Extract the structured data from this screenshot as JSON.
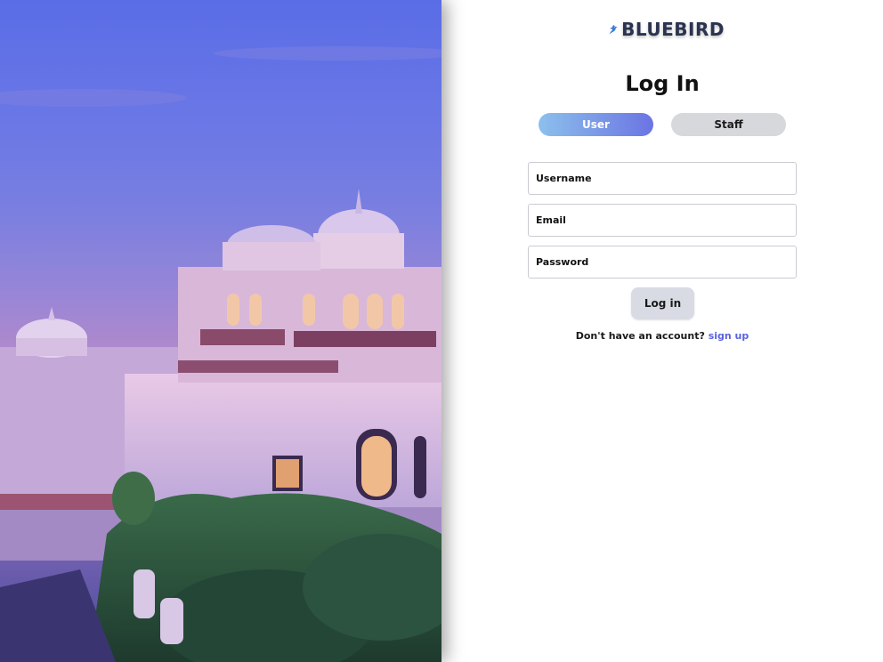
{
  "brand": {
    "name": "BLUEBIRD",
    "logo_icon": "bluebird-icon",
    "colors": {
      "dark": "#2b3350",
      "blue": "#3a7bd5"
    }
  },
  "hero": {
    "image": "palace-at-dusk-photo"
  },
  "login": {
    "title": "Log In",
    "tabs": [
      {
        "label": "User",
        "active": true
      },
      {
        "label": "Staff",
        "active": false
      }
    ],
    "fields": {
      "username": {
        "placeholder": "Username",
        "value": ""
      },
      "email": {
        "placeholder": "Email",
        "value": ""
      },
      "password": {
        "placeholder": "Password",
        "value": ""
      }
    },
    "submit_label": "Log in",
    "signup_prompt": "Don't have an account?",
    "signup_link": "sign up"
  },
  "colors": {
    "accent": "#5b62e0",
    "tab_active_start": "#8cc0ec",
    "tab_active_end": "#6b74e3",
    "tab_inactive": "#d6d8dc",
    "button_bg": "#d8dbe3"
  }
}
